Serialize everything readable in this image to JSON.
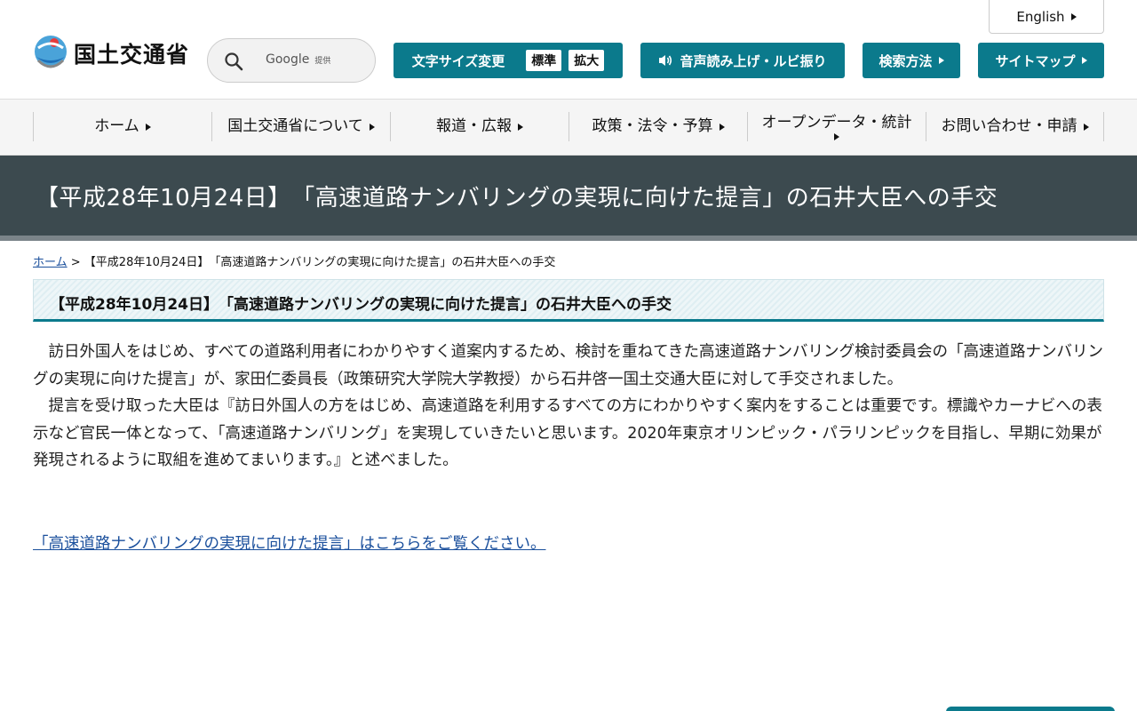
{
  "header": {
    "logo_text": "国土交通省",
    "search": {
      "provider": "Google",
      "provider_suffix": "提供"
    },
    "english_label": "English",
    "font_size": {
      "label": "文字サイズ変更",
      "options": [
        "標準",
        "拡大"
      ]
    },
    "voice_label": "音声読み上げ・ルビ振り",
    "search_help_label": "検索方法",
    "sitemap_label": "サイトマップ"
  },
  "nav": {
    "items": [
      {
        "label": "ホーム"
      },
      {
        "label": "国土交通省について"
      },
      {
        "label": "報道・広報"
      },
      {
        "label": "政策・法令・予算"
      },
      {
        "label": "オープンデータ・統計"
      },
      {
        "label": "お問い合わせ・申請"
      }
    ]
  },
  "page": {
    "title": "【平成28年10月24日】　「高速道路ナンバリングの実現に向けた提言」の石井大臣への手交",
    "breadcrumb": {
      "home": "ホーム",
      "separator": " > ",
      "current": "【平成28年10月24日】　「高速道路ナンバリングの実現に向けた提言」の石井大臣への手交"
    },
    "section_heading": "【平成28年10月24日】　「高速道路ナンバリングの実現に向けた提言」の石井大臣への手交",
    "paragraphs": [
      "訪日外国人をはじめ、すべての道路利用者にわかりやすく道案内するため、検討を重ねてきた高速道路ナンバリング検討委員会の「高速道路ナンバリングの実現に向けた提言」が、家田仁委員長（政策研究大学院大学教授）から石井啓一国土交通大臣に対して手交されました。",
      "提言を受け取った大臣は『訪日外国人の方をはじめ、高速道路を利用するすべての方にわかりやすく案内をすることは重要です。標識やカーナビへの表示など官民一体となって、「高速道路ナンバリング」を実現していきたいと思います。2020年東京オリンピック・パラリンピックを目指し、早期に効果が発現されるように取組を進めてまいります。』と述べました。"
    ],
    "link_text": "「高速道路ナンバリングの実現に向けた提言」はこちらをご覧ください。"
  },
  "colors": {
    "accent": "#0b7a8c",
    "title_band": "#3c4a4f",
    "link": "#1a4f9c"
  }
}
